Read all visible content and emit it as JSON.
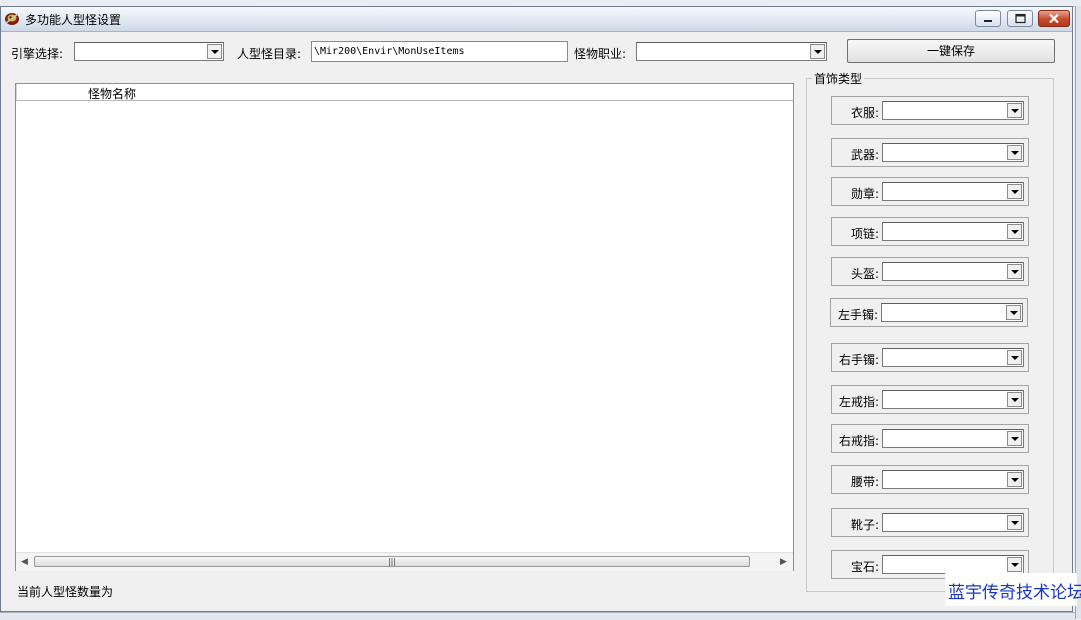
{
  "window": {
    "title": "多功能人型怪设置"
  },
  "toolbar": {
    "engine_label": "引擎选择:",
    "engine_value": "",
    "dir_label": "人型怪目录:",
    "dir_value": "\\Mir200\\Envir\\MonUseItems",
    "job_label": "怪物职业:",
    "job_value": "",
    "save_label": "一键保存"
  },
  "list": {
    "columns": [
      "怪物名称"
    ],
    "rows": []
  },
  "equipment": {
    "group_title": "首饰类型",
    "slots": [
      {
        "label": "衣服:",
        "value": ""
      },
      {
        "label": "武器:",
        "value": ""
      },
      {
        "label": "勋章:",
        "value": ""
      },
      {
        "label": "项链:",
        "value": ""
      },
      {
        "label": "头盔:",
        "value": ""
      },
      {
        "label": "左手镯:",
        "value": ""
      },
      {
        "label": "右手镯:",
        "value": ""
      },
      {
        "label": "左戒指:",
        "value": ""
      },
      {
        "label": "右戒指:",
        "value": ""
      },
      {
        "label": "腰带:",
        "value": ""
      },
      {
        "label": "靴子:",
        "value": ""
      },
      {
        "label": "宝石:",
        "value": ""
      }
    ]
  },
  "status": {
    "text": "当前人型怪数量为"
  },
  "watermark": {
    "text": "蓝宇传奇技术论坛"
  },
  "colors": {
    "watermark": "#1a34c8",
    "close_button": "#c44b2f",
    "window_bg": "#f0f0f0"
  },
  "icons": {
    "app": "app-icon",
    "minimize": "minimize-icon",
    "maximize": "maximize-icon",
    "close": "close-icon",
    "dropdown": "chevron-down-icon"
  }
}
